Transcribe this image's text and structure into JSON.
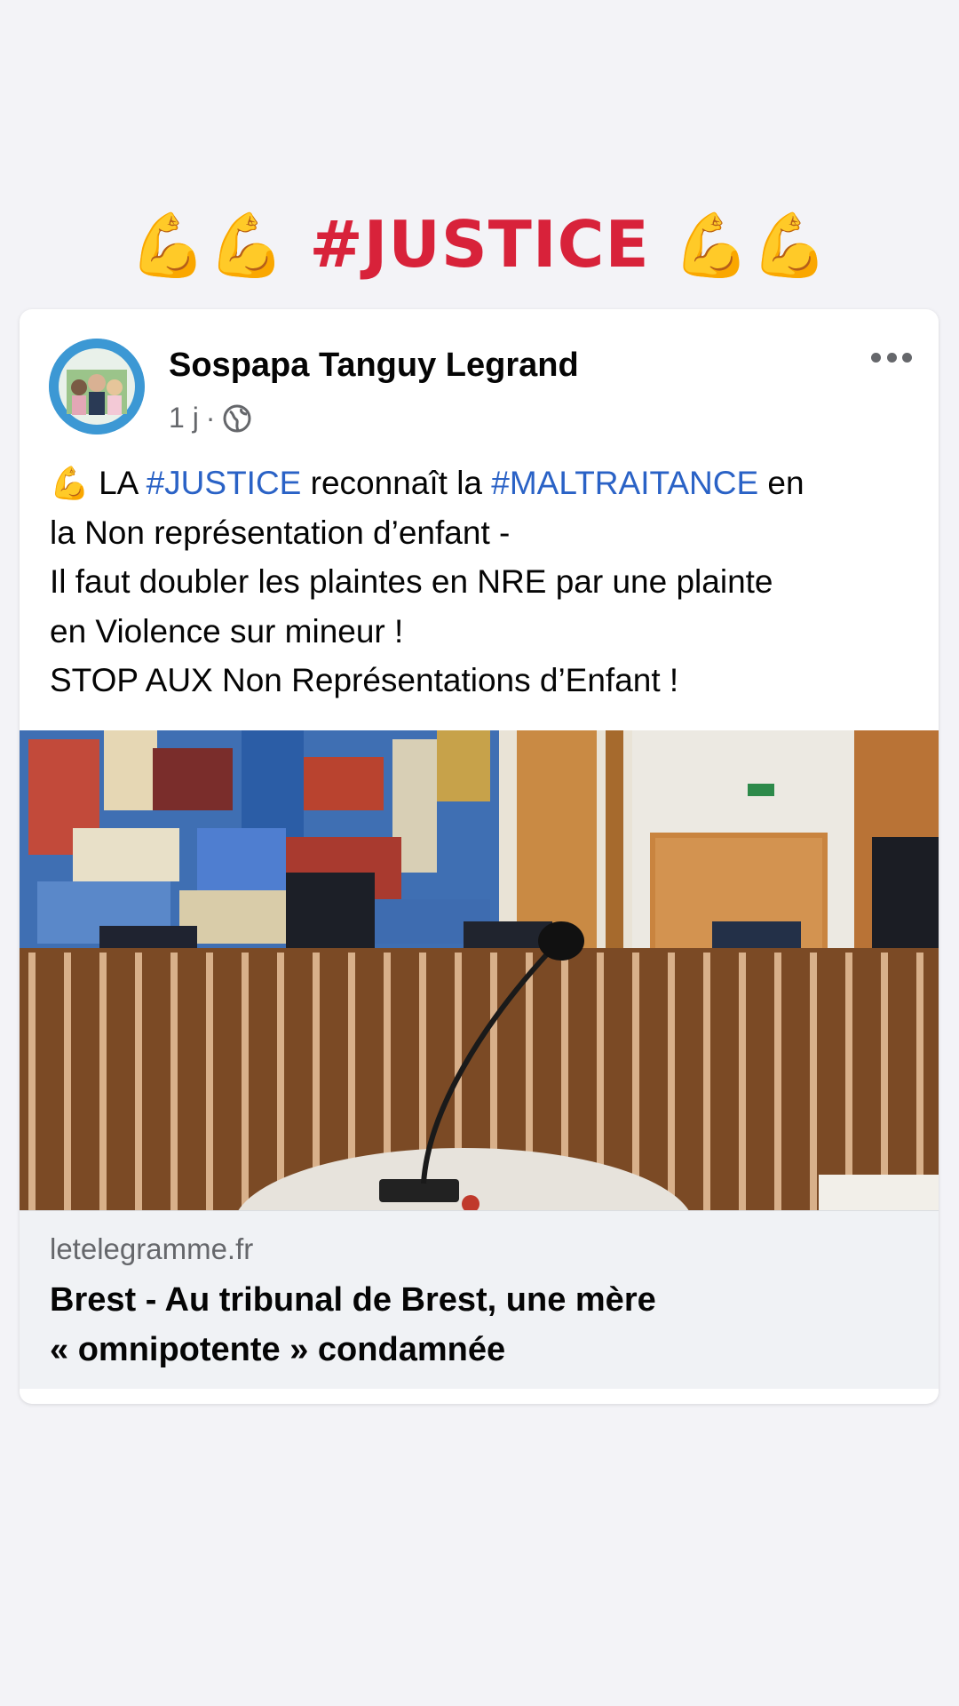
{
  "banner": {
    "emoji_left": "💪💪",
    "text": "#JUSTICE",
    "emoji_right": "💪💪",
    "color": "#d8223a"
  },
  "post": {
    "author": "Sospapa Tanguy Legrand",
    "timestamp": "1 j",
    "separator": "·",
    "privacy_icon": "globe-icon",
    "more_icon": "more-options-icon",
    "avatar_icon": "profile-avatar",
    "text": {
      "line1_emoji": "💪",
      "line1_a": " LA ",
      "line1_tag1": "#JUSTICE",
      "line1_b": " reconnaît la ",
      "line1_tag2": "#MALTRAITANCE",
      "line1_c": " en",
      "line2": "la Non représentation d’enfant -",
      "line3": "Il faut doubler les plaintes en NRE par une plainte",
      "line4": "en Violence sur mineur !",
      "line5": "STOP AUX Non Représentations d’Enfant !"
    },
    "hashtag_color": "#2a62c6",
    "link": {
      "domain": "letelegramme.fr",
      "title_line1": "Brest - Au tribunal de Brest, une mère",
      "title_line2": "« omnipotente » condamnée"
    }
  }
}
